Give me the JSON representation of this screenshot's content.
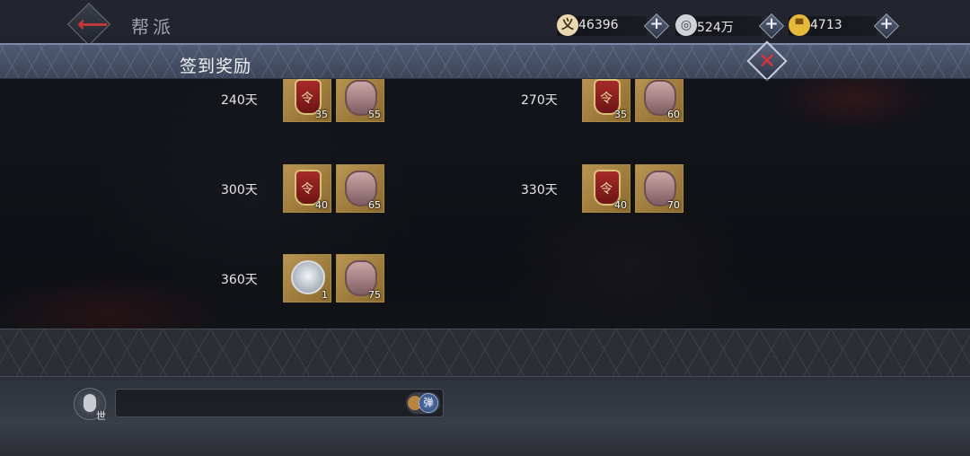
{
  "header": {
    "back_icon": "back-arrow-icon",
    "title": "帮派",
    "resources": [
      {
        "icon": "yi-coin-icon",
        "glyph": "义",
        "value": "46396"
      },
      {
        "icon": "copper-coin-icon",
        "glyph": "◎",
        "value": "524万"
      },
      {
        "icon": "gold-ingot-icon",
        "glyph": "▀",
        "value": "4713"
      }
    ]
  },
  "dialog": {
    "title": "签到奖励",
    "close_icon": "close-icon"
  },
  "rewards": [
    {
      "label": "240天",
      "items": [
        {
          "type": "token",
          "qty": "35"
        },
        {
          "type": "fragment",
          "qty": "55"
        }
      ]
    },
    {
      "label": "270天",
      "items": [
        {
          "type": "token",
          "qty": "35"
        },
        {
          "type": "fragment",
          "qty": "60"
        }
      ]
    },
    {
      "label": "300天",
      "items": [
        {
          "type": "token",
          "qty": "40"
        },
        {
          "type": "fragment",
          "qty": "65"
        }
      ]
    },
    {
      "label": "330天",
      "items": [
        {
          "type": "token",
          "qty": "40"
        },
        {
          "type": "fragment",
          "qty": "70"
        }
      ]
    },
    {
      "label": "360天",
      "items": [
        {
          "type": "silver-token",
          "qty": "1"
        },
        {
          "type": "fragment",
          "qty": "75"
        }
      ]
    }
  ],
  "chat": {
    "channel": "世",
    "toggle_label": "弹"
  },
  "colors": {
    "accent_red": "#c23a3a",
    "item_border": "#a98a44",
    "header_band": "#4f5a72"
  }
}
